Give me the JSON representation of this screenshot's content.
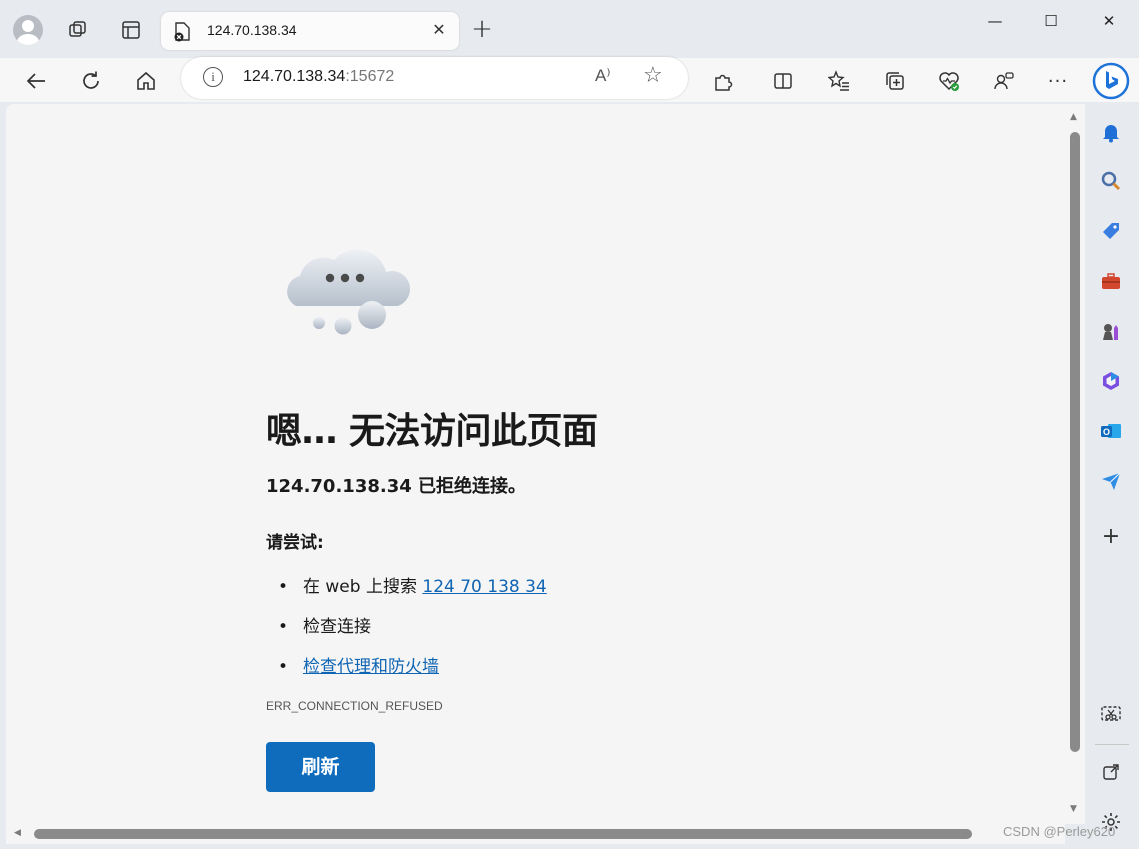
{
  "tab": {
    "title": "124.70.138.34",
    "close_label": "✕",
    "new_tab_label": "+"
  },
  "window": {
    "minimize": "—",
    "maximize": "☐",
    "close": "✕"
  },
  "address_bar": {
    "host": "124.70.138.34",
    "port": ":15672",
    "read_aloud": "A⁾"
  },
  "page": {
    "title": "嗯… 无法访问此页面",
    "subtitle": "124.70.138.34 已拒绝连接。",
    "try_label": "请尝试:",
    "suggestions": {
      "search_prefix": "在 web 上搜索",
      "search_link": "124 70 138 34",
      "check_connection": "检查连接",
      "check_proxy": "检查代理和防火墙"
    },
    "error_code": "ERR_CONNECTION_REFUSED",
    "refresh_label": "刷新"
  },
  "watermark": "CSDN @Perley620",
  "colors": {
    "accent": "#0f6cbd",
    "link": "#0f65b3"
  },
  "icons": {
    "sidebar": [
      "bell-icon",
      "search-icon",
      "tag-icon",
      "briefcase-icon",
      "chess-icon",
      "office-icon",
      "outlook-icon",
      "send-icon",
      "add-icon",
      "screenshot-icon",
      "external-link-icon",
      "settings-icon"
    ]
  }
}
